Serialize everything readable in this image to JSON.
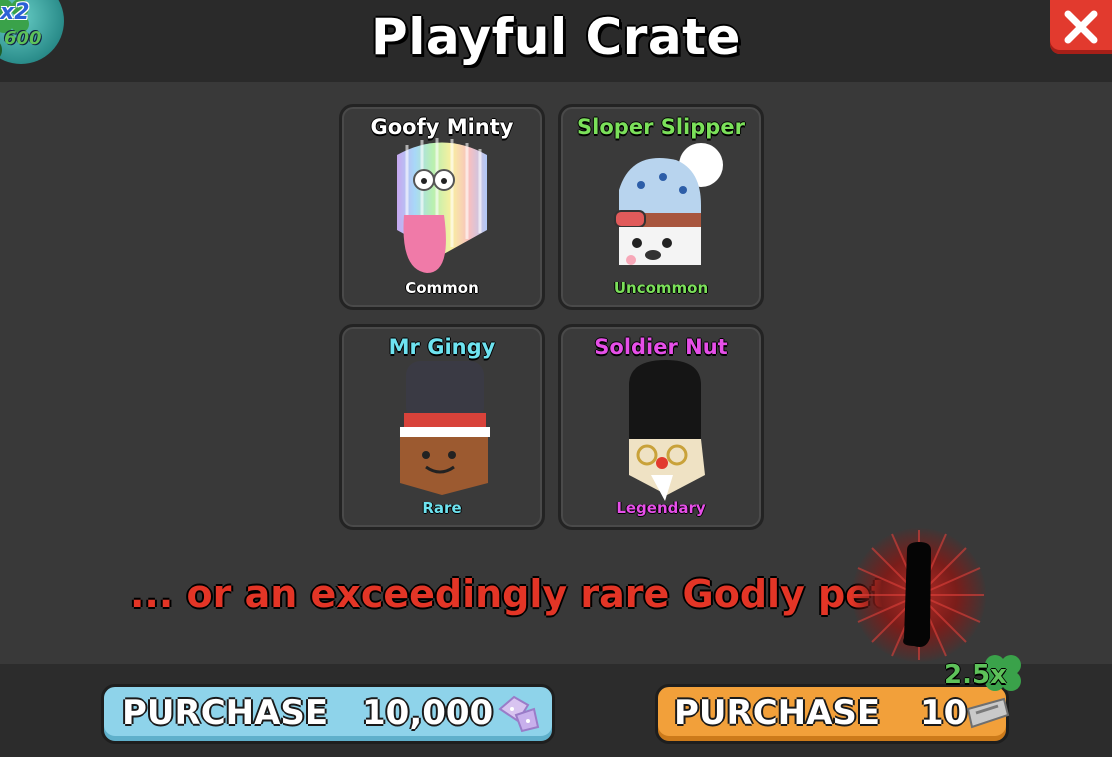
{
  "title": "Playful Crate",
  "luck_badge": {
    "multiplier": "x2",
    "count": "600"
  },
  "pets": [
    {
      "name": "Goofy Minty",
      "rarity": "Common",
      "name_color": "#ffffff",
      "rarity_color": "#ffffff",
      "icon": "goofy-minty-pet-icon"
    },
    {
      "name": "Sloper Slipper",
      "rarity": "Uncommon",
      "name_color": "#7be05a",
      "rarity_color": "#7be05a",
      "icon": "sloper-slipper-pet-icon"
    },
    {
      "name": "Mr Gingy",
      "rarity": "Rare",
      "name_color": "#6ee3f0",
      "rarity_color": "#6ee3f0",
      "icon": "mr-gingy-pet-icon"
    },
    {
      "name": "Soldier Nut",
      "rarity": "Legendary",
      "name_color": "#e64fe8",
      "rarity_color": "#e64fe8",
      "icon": "soldier-nut-pet-icon"
    }
  ],
  "godly_text": "... or an exceedingly rare Godly pet!",
  "godly_color": "#e33526",
  "purchase_gems": {
    "label": "PURCHASE",
    "price": "10,000",
    "icon": "gingerbread-gem-icon"
  },
  "purchase_tickets": {
    "label": "PURCHASE",
    "price": "10",
    "icon": "ticket-icon",
    "boost": "2.5x"
  },
  "colors": {
    "gems_button": "#8ed3ea",
    "tickets_button": "#f2a03a",
    "close_button": "#e23a2e"
  }
}
